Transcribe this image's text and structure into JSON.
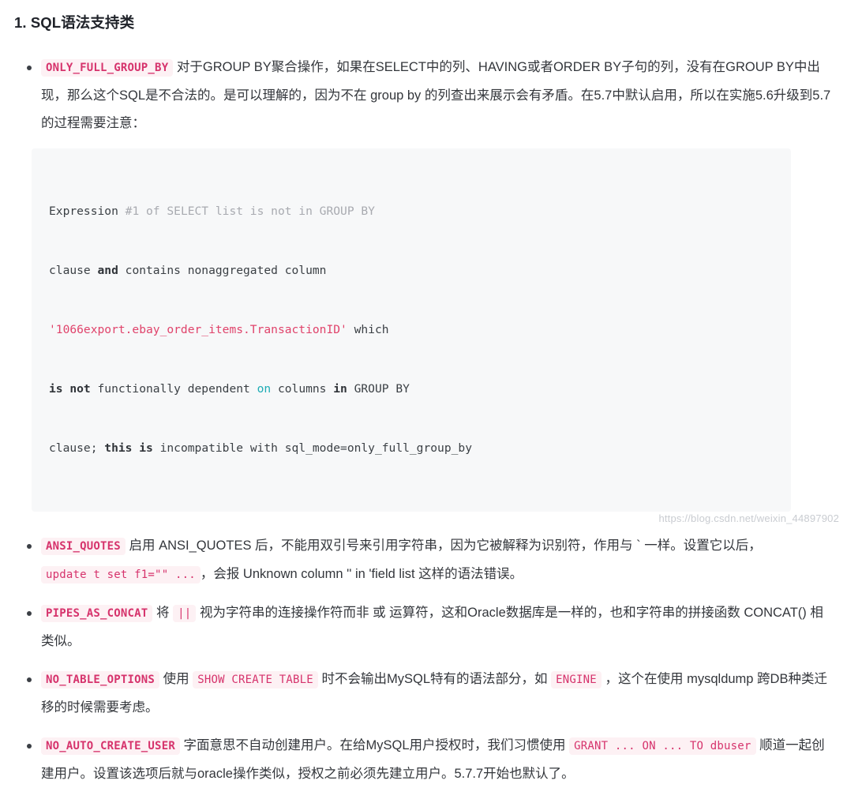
{
  "document": {
    "title": "1. SQL语法支持类",
    "watermark": "https://blog.csdn.net/weixin_44897902",
    "colors": {
      "inline_code_bg": "#fdf1f4",
      "inline_code_fg": "#d6336c",
      "code_block_bg": "#f7f8f9",
      "string_token": "#e0436b",
      "operator_token": "#1eacb5",
      "comment_token": "#a8aab0",
      "body_text": "#33363b"
    }
  },
  "bullets": [
    {
      "code": "ONLY_FULL_GROUP_BY",
      "text_1": "对于GROUP BY聚合操作，如果在SELECT中的列、HAVING或者ORDER BY子句的列，没有在GROUP BY中出现，那么这个SQL是不合法的。是可以理解的，因为不在 group by 的列查出来展示会有矛盾。在5.7中默认启用，所以在实施5.6升级到5.7的过程需要注意："
    },
    {
      "code": "ANSI_QUOTES",
      "text_1": "启用 ANSI_QUOTES 后，不能用双引号来引用字符串，因为它被解释为识别符，作用与 ` 一样。设置它以后，",
      "code_2": "update t set f1=\"\" ...",
      "text_2": "，会报 Unknown column '' in 'field list 这样的语法错误。"
    },
    {
      "code": "PIPES_AS_CONCAT",
      "text_1": "将",
      "code_2": "||",
      "text_2": "视为字符串的连接操作符而非 或 运算符，这和Oracle数据库是一样的，也和字符串的拼接函数 CONCAT() 相类似。"
    },
    {
      "code": "NO_TABLE_OPTIONS",
      "text_1": "使用",
      "code_2": "SHOW CREATE TABLE",
      "text_2": "时不会输出MySQL特有的语法部分，如",
      "code_3": "ENGINE",
      "text_3": "，这个在使用 mysqldump 跨DB种类迁移的时候需要考虑。"
    },
    {
      "code": "NO_AUTO_CREATE_USER",
      "text_1": "字面意思不自动创建用户。在给MySQL用户授权时，我们习惯使用",
      "code_2": "GRANT ... ON ... TO dbuser",
      "text_2": "顺道一起创建用户。设置该选项后就与oracle操作类似，授权之前必须先建立用户。5.7.7开始也默认了。"
    }
  ],
  "code_block": {
    "lines": [
      [
        {
          "t": "Expression ",
          "c": "plain"
        },
        {
          "t": "#1 of SELECT list is not in GROUP BY",
          "c": "dim"
        }
      ],
      [
        {
          "t": "clause ",
          "c": "plain"
        },
        {
          "t": "and",
          "c": "kw"
        },
        {
          "t": " contains nonaggregated column",
          "c": "plain"
        }
      ],
      [
        {
          "t": "'1066export.ebay_order_items.TransactionID'",
          "c": "str"
        },
        {
          "t": " which",
          "c": "plain"
        }
      ],
      [
        {
          "t": "is not",
          "c": "kw"
        },
        {
          "t": " functionally dependent ",
          "c": "plain"
        },
        {
          "t": "on",
          "c": "op"
        },
        {
          "t": " columns ",
          "c": "plain"
        },
        {
          "t": "in",
          "c": "kw"
        },
        {
          "t": " GROUP BY",
          "c": "plain"
        }
      ],
      [
        {
          "t": "clause; ",
          "c": "plain"
        },
        {
          "t": "this is",
          "c": "kw"
        },
        {
          "t": " incompatible with sql_mode=only_full_group_by",
          "c": "plain"
        }
      ]
    ]
  }
}
